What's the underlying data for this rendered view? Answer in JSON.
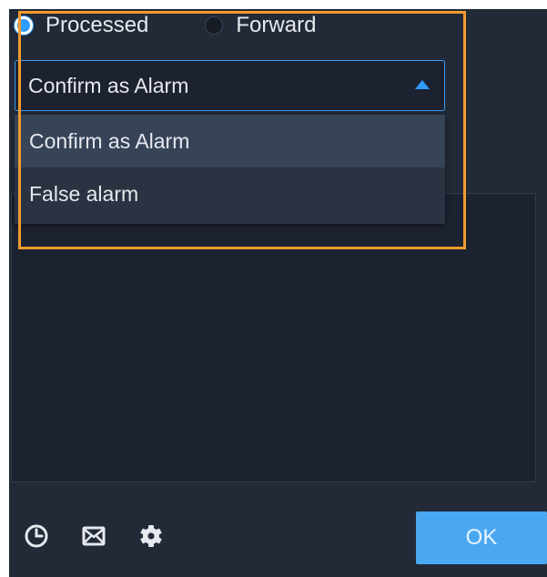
{
  "handle": {
    "options": [
      {
        "label": "Processed",
        "checked": true
      },
      {
        "label": "Forward",
        "checked": false
      }
    ]
  },
  "select": {
    "value": "Confirm as Alarm",
    "options": [
      "Confirm as Alarm",
      "False alarm"
    ],
    "hovered_index": 0
  },
  "textarea": {
    "value": ""
  },
  "footer": {
    "icons": [
      "clock-icon",
      "mail-icon",
      "gear-icon"
    ],
    "ok_label": "OK"
  },
  "colors": {
    "panel_bg": "#222a38",
    "accent": "#2f9bff",
    "highlight": "#f39a2e",
    "ok_button": "#4aa8f2"
  }
}
